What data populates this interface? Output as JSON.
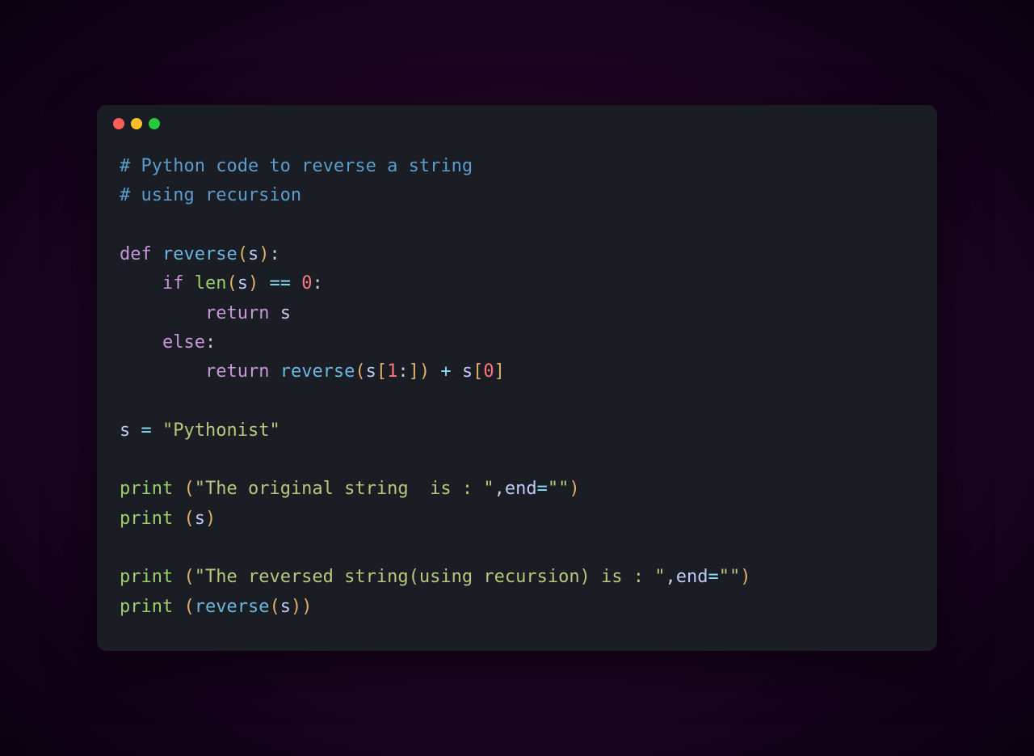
{
  "code": {
    "comment1": "# Python code to reverse a string",
    "comment2": "# using recursion",
    "def_kw": "def",
    "func_name": "reverse",
    "param_s": "s",
    "if_kw": "if",
    "len_fn": "len",
    "eq_op": "==",
    "zero": "0",
    "return_kw": "return",
    "else_kw": "else",
    "slice_1": "1",
    "slice_colon": ":",
    "plus_op": "+",
    "idx_0": "0",
    "assign_op": "=",
    "str_pythonist": "\"Pythonist\"",
    "print_fn": "print",
    "str_original": "\"The original string  is : \"",
    "end_kw": "end",
    "str_empty": "\"\"",
    "str_reversed": "\"The reversed string(using recursion) is : \"",
    "colon": ":",
    "lparen": "(",
    "rparen": ")",
    "lbracket": "[",
    "rbracket": "]",
    "comma": ","
  }
}
